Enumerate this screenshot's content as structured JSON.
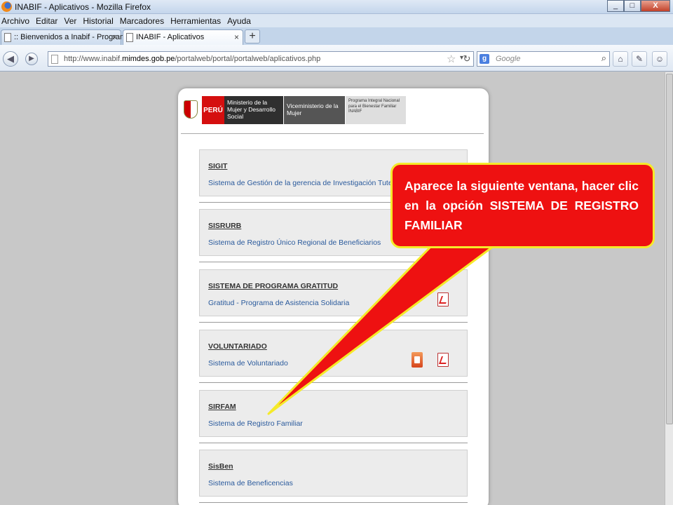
{
  "window": {
    "title": "INABIF - Aplicativos - Mozilla Firefox",
    "min": "_",
    "max": "□",
    "close": "X"
  },
  "menu": [
    "Archivo",
    "Editar",
    "Ver",
    "Historial",
    "Marcadores",
    "Herramientas",
    "Ayuda"
  ],
  "tabs": [
    {
      "label": ":: Bienvenidos a Inabif - Programa Int...",
      "close": "×"
    },
    {
      "label": "INABIF - Aplicativos",
      "close": "×"
    }
  ],
  "new_tab": "+",
  "nav": {
    "url_prefix": "http://www.inabif.",
    "url_domain": "mimdes.gob.pe",
    "url_suffix": "/portalweb/portal/portalweb/aplicativos.php",
    "search_engine": "Google",
    "search_engine_letter": "g"
  },
  "header": {
    "country": "PERÚ",
    "ministry": "Ministerio de la Mujer y Desarrollo Social",
    "vice": "Viceministerio de la Mujer",
    "program": "Programa Integral Nacional para el Bienestar Familiar INABIF"
  },
  "apps": [
    {
      "title": "SIGIT",
      "desc": "Sistema de Gestión de la gerencia de Investigación Tutelar"
    },
    {
      "title": "SISRURB",
      "desc": "Sistema de Registro Único Regional de Beneficiarios"
    },
    {
      "title": "SISTEMA DE PROGRAMA GRATITUD",
      "desc": "Gratitud - Programa de Asistencia Solidaria"
    },
    {
      "title": "VOLUNTARIADO",
      "desc": "Sistema de Voluntariado"
    },
    {
      "title": "SIRFAM",
      "desc": "Sistema de Registro Familiar"
    },
    {
      "title": "SisBen",
      "desc": "Sistema de Beneficencias"
    }
  ],
  "callout": {
    "text": "Aparece la siguiente ventana, hacer clic en la opción SISTEMA DE REGISTRO FAMILIAR",
    "fill": "#ee1111",
    "border": "#f5ea2a"
  }
}
